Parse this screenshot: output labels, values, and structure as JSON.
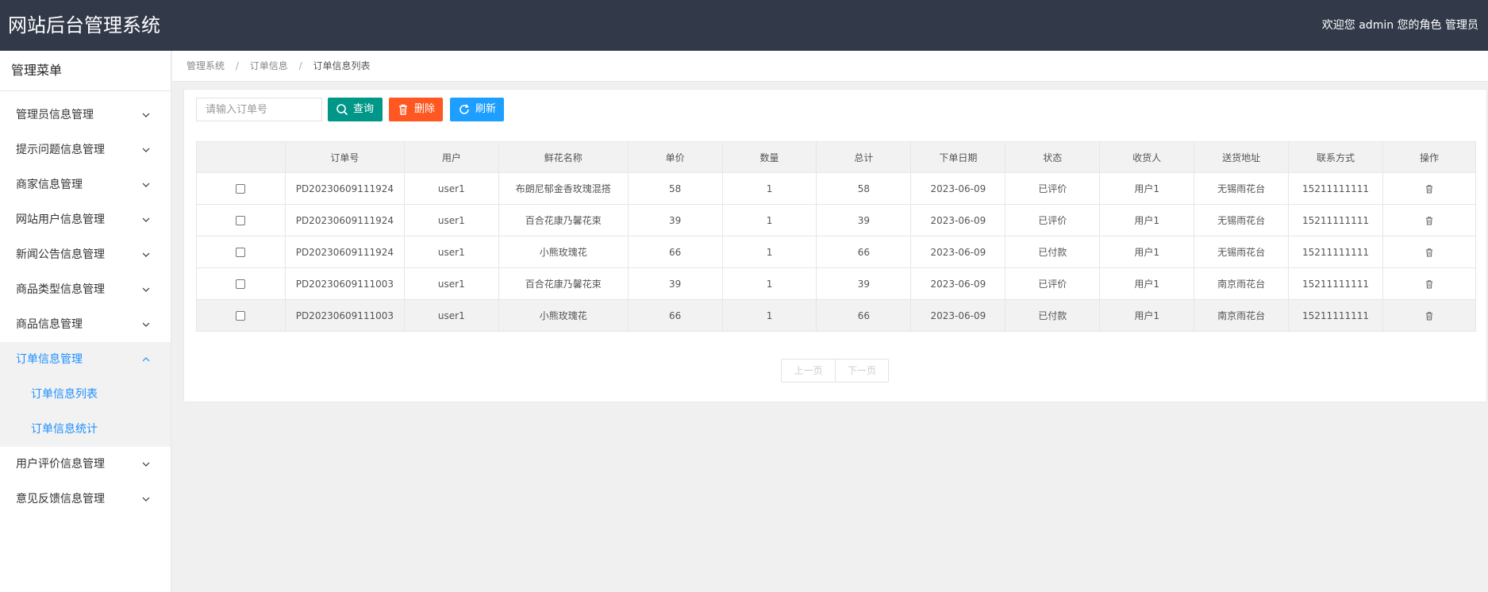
{
  "header": {
    "title": "网站后台管理系统",
    "welcome": "欢迎您 admin 您的角色 管理员"
  },
  "sidebar": {
    "title": "管理菜单",
    "items": [
      {
        "label": "管理员信息管理"
      },
      {
        "label": "提示问题信息管理"
      },
      {
        "label": "商家信息管理"
      },
      {
        "label": "网站用户信息管理"
      },
      {
        "label": "新闻公告信息管理"
      },
      {
        "label": "商品类型信息管理"
      },
      {
        "label": "商品信息管理"
      },
      {
        "label": "订单信息管理",
        "subitems": [
          "订单信息列表",
          "订单信息统计"
        ]
      },
      {
        "label": "用户评价信息管理"
      },
      {
        "label": "意见反馈信息管理"
      }
    ]
  },
  "breadcrumb": [
    "管理系统",
    "订单信息",
    "订单信息列表"
  ],
  "breadcrumb_sep": "/",
  "toolbar": {
    "search_placeholder": "请输入订单号",
    "query_label": "查询",
    "delete_label": "删除",
    "refresh_label": "刷新"
  },
  "table": {
    "columns": [
      "",
      "订单号",
      "用户",
      "鲜花名称",
      "单价",
      "数量",
      "总计",
      "下单日期",
      "状态",
      "收货人",
      "送货地址",
      "联系方式",
      "操作"
    ],
    "rows": [
      [
        "PD20230609111924",
        "user1",
        "布朗尼郁金香玫瑰混搭",
        "58",
        "1",
        "58",
        "2023-06-09",
        "已评价",
        "用户1",
        "无锡雨花台",
        "15211111111"
      ],
      [
        "PD20230609111924",
        "user1",
        "百合花康乃馨花束",
        "39",
        "1",
        "39",
        "2023-06-09",
        "已评价",
        "用户1",
        "无锡雨花台",
        "15211111111"
      ],
      [
        "PD20230609111924",
        "user1",
        "小熊玫瑰花",
        "66",
        "1",
        "66",
        "2023-06-09",
        "已付款",
        "用户1",
        "无锡雨花台",
        "15211111111"
      ],
      [
        "PD20230609111003",
        "user1",
        "百合花康乃馨花束",
        "39",
        "1",
        "39",
        "2023-06-09",
        "已评价",
        "用户1",
        "南京雨花台",
        "15211111111"
      ],
      [
        "PD20230609111003",
        "user1",
        "小熊玫瑰花",
        "66",
        "1",
        "66",
        "2023-06-09",
        "已付款",
        "用户1",
        "南京雨花台",
        "15211111111"
      ]
    ]
  },
  "pager": {
    "prev": "上一页",
    "next": "下一页"
  },
  "colors": {
    "header_bg": "#323a4a",
    "query_btn": "#009688",
    "delete_btn": "#ff5722",
    "refresh_btn": "#1e9fff",
    "active_menu": "#1e90ff"
  }
}
